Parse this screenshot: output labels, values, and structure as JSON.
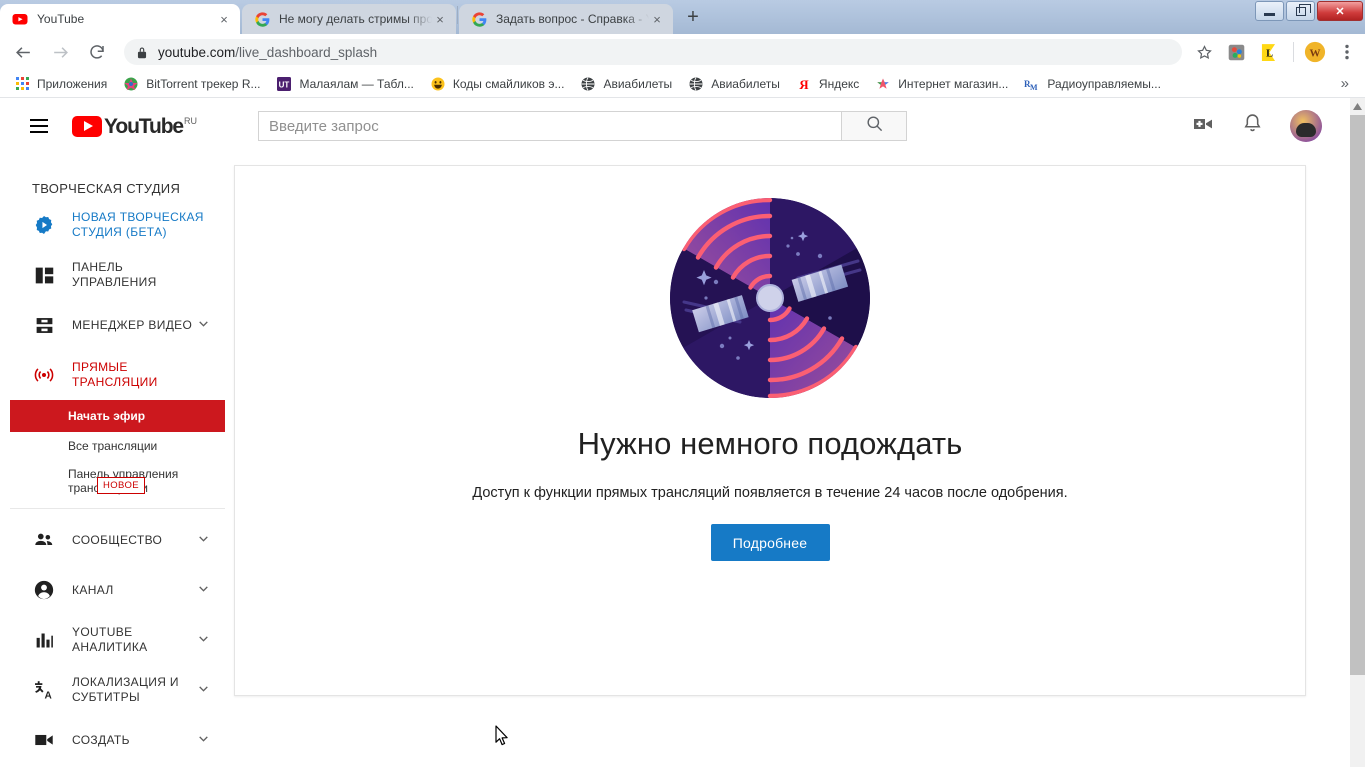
{
  "browser": {
    "tabs": [
      {
        "title": "YouTube",
        "favicon": "youtube-icon",
        "active": true,
        "close_label": "×"
      },
      {
        "title": "Не могу делать стримы прошло",
        "favicon": "google-icon",
        "active": false,
        "close_label": "×"
      },
      {
        "title": "Задать вопрос - Справка - YouT",
        "favicon": "google-icon",
        "active": false,
        "close_label": "×"
      }
    ],
    "new_tab_label": "+",
    "window_controls": {
      "minimize": "minimize-icon",
      "maximize": "maximize-icon",
      "close": "✕"
    },
    "url_domain": "youtube.com",
    "url_path": "/live_dashboard_splash",
    "nav": {
      "back": "back-arrow-icon",
      "forward": "forward-arrow-icon",
      "reload": "reload-icon"
    },
    "omnibox_icons": {
      "lock": "lock-icon",
      "bookmark_star": "star-icon",
      "menu": "three-dot-menu-icon"
    },
    "extensions": [
      {
        "name": "colorzilla-extension-icon",
        "glyph": "■"
      },
      {
        "name": "yellow-l-extension-icon",
        "glyph": "L"
      },
      {
        "name": "profile-avatar-icon",
        "glyph": "●"
      }
    ],
    "bookmarks": [
      {
        "label": "Приложения",
        "icon": "apps-grid-icon"
      },
      {
        "label": "BitTorrent трекер R...",
        "icon": "bittorrent-icon"
      },
      {
        "label": "Малаялам — Табл...",
        "icon": "ut-icon"
      },
      {
        "label": "Коды смайликов э...",
        "icon": "smiley-icon"
      },
      {
        "label": "Авиабилеты",
        "icon": "globe-icon"
      },
      {
        "label": "Авиабилеты",
        "icon": "globe-icon"
      },
      {
        "label": "Яндекс",
        "icon": "yandex-icon"
      },
      {
        "label": "Интернет магазин...",
        "icon": "chrome-webstore-icon"
      },
      {
        "label": "Радиоуправляемы...",
        "icon": "rm-icon"
      }
    ],
    "bookmarks_overflow": "»"
  },
  "youtube_header": {
    "menu_icon": "hamburger-icon",
    "logo_text": "YouTube",
    "country_code": "RU",
    "search_placeholder": "Введите запрос",
    "search_value": "",
    "search_button_icon": "search-icon",
    "create_video_icon": "video-camera-plus-icon",
    "notifications_icon": "bell-icon",
    "avatar_icon": "user-avatar"
  },
  "sidebar": {
    "title": "ТВОРЧЕСКАЯ СТУДИЯ",
    "items": [
      {
        "label": "НОВАЯ ТВОРЧЕСКАЯ СТУДИЯ (БЕТА)",
        "icon": "gear-play-icon",
        "caret": false,
        "style": "beta"
      },
      {
        "label": "ПАНЕЛЬ УПРАВЛЕНИЯ",
        "icon": "dashboard-icon",
        "caret": false,
        "style": "normal"
      },
      {
        "label": "МЕНЕДЖЕР ВИДЕО",
        "icon": "video-manager-icon",
        "caret": true,
        "style": "normal"
      },
      {
        "label": "ПРЯМЫЕ ТРАНСЛЯЦИИ",
        "icon": "live-broadcast-icon",
        "caret": false,
        "style": "active"
      }
    ],
    "sub_items": [
      {
        "label": "Начать эфир",
        "selected": true,
        "badge": null
      },
      {
        "label": "Все трансляции",
        "selected": false,
        "badge": null
      },
      {
        "label": "Панель управления трансляциями",
        "selected": false,
        "badge": "НОВОЕ"
      }
    ],
    "items_lower": [
      {
        "label": "СООБЩЕСТВО",
        "icon": "people-icon",
        "caret": true
      },
      {
        "label": "КАНАЛ",
        "icon": "account-circle-icon",
        "caret": true
      },
      {
        "label": "YOUTUBE АНАЛИТИКА",
        "icon": "bar-chart-icon",
        "caret": true
      },
      {
        "label": "ЛОКАЛИЗАЦИЯ И СУБТИТРЫ",
        "icon": "translate-icon",
        "caret": true
      },
      {
        "label": "СОЗДАТЬ",
        "icon": "movie-camera-icon",
        "caret": true
      }
    ]
  },
  "main": {
    "illustration": "satellite-radar-illustration",
    "headline": "Нужно немного подождать",
    "subtext": "Доступ к функции прямых трансляций появляется в течение 24 часов после одобрения.",
    "button_label": "Подробнее"
  },
  "colors": {
    "youtube_red": "#ff0000",
    "selected_red": "#cc181e",
    "link_blue": "#167ac6",
    "button_blue": "#167ac6",
    "illustration_purple": "#5b2f9e",
    "illustration_navy": "#2a1a5e",
    "illustration_pink": "#fb5f73"
  }
}
